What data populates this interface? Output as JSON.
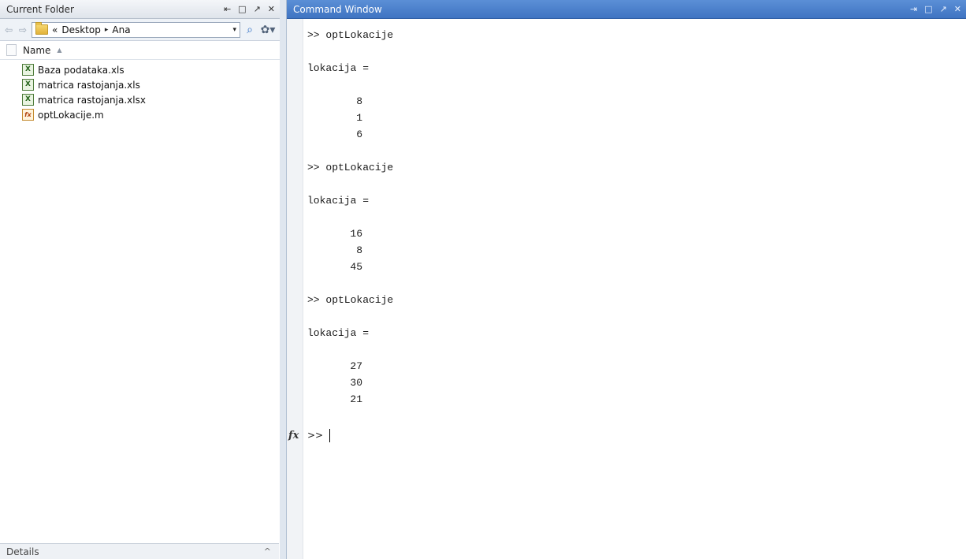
{
  "current_folder": {
    "title": "Current Folder",
    "controls": {
      "undock": "⇤",
      "maximize": "□",
      "float": "↗",
      "close": "✕"
    },
    "nav": {
      "back": "⇦",
      "forward": "⇨",
      "breadcrumb_prefix": "«",
      "path": [
        "Desktop",
        "Ana"
      ],
      "path_separator": "▸",
      "dropdown": "▾",
      "search_icon": "⌕",
      "gear_icon": "✿▾"
    },
    "column": {
      "name_label": "Name",
      "sort_indicator": "▲"
    },
    "files": [
      {
        "name": "Baza podataka.xls",
        "icon": "xls-icon"
      },
      {
        "name": "matrica rastojanja.xls",
        "icon": "xls-icon"
      },
      {
        "name": "matrica rastojanja.xlsx",
        "icon": "xlsx-icon"
      },
      {
        "name": "optLokacije.m",
        "icon": "m-file-icon"
      }
    ],
    "details_label": "Details",
    "details_toggle": "^"
  },
  "command_window": {
    "title": "Command Window",
    "controls": {
      "dock": "⇥",
      "maximize": "□",
      "float": "↗",
      "close": "✕"
    },
    "blocks": [
      {
        "command": ">> optLokacije",
        "var_line": "lokacija =",
        "values": [
          "8",
          "1",
          "6"
        ]
      },
      {
        "command": ">> optLokacije",
        "var_line": "lokacija =",
        "values": [
          "16",
          "8",
          "45"
        ]
      },
      {
        "command": ">> optLokacije",
        "var_line": "lokacija =",
        "values": [
          "27",
          "30",
          "21"
        ]
      }
    ],
    "fx_label": "fx",
    "prompt": ">>"
  }
}
